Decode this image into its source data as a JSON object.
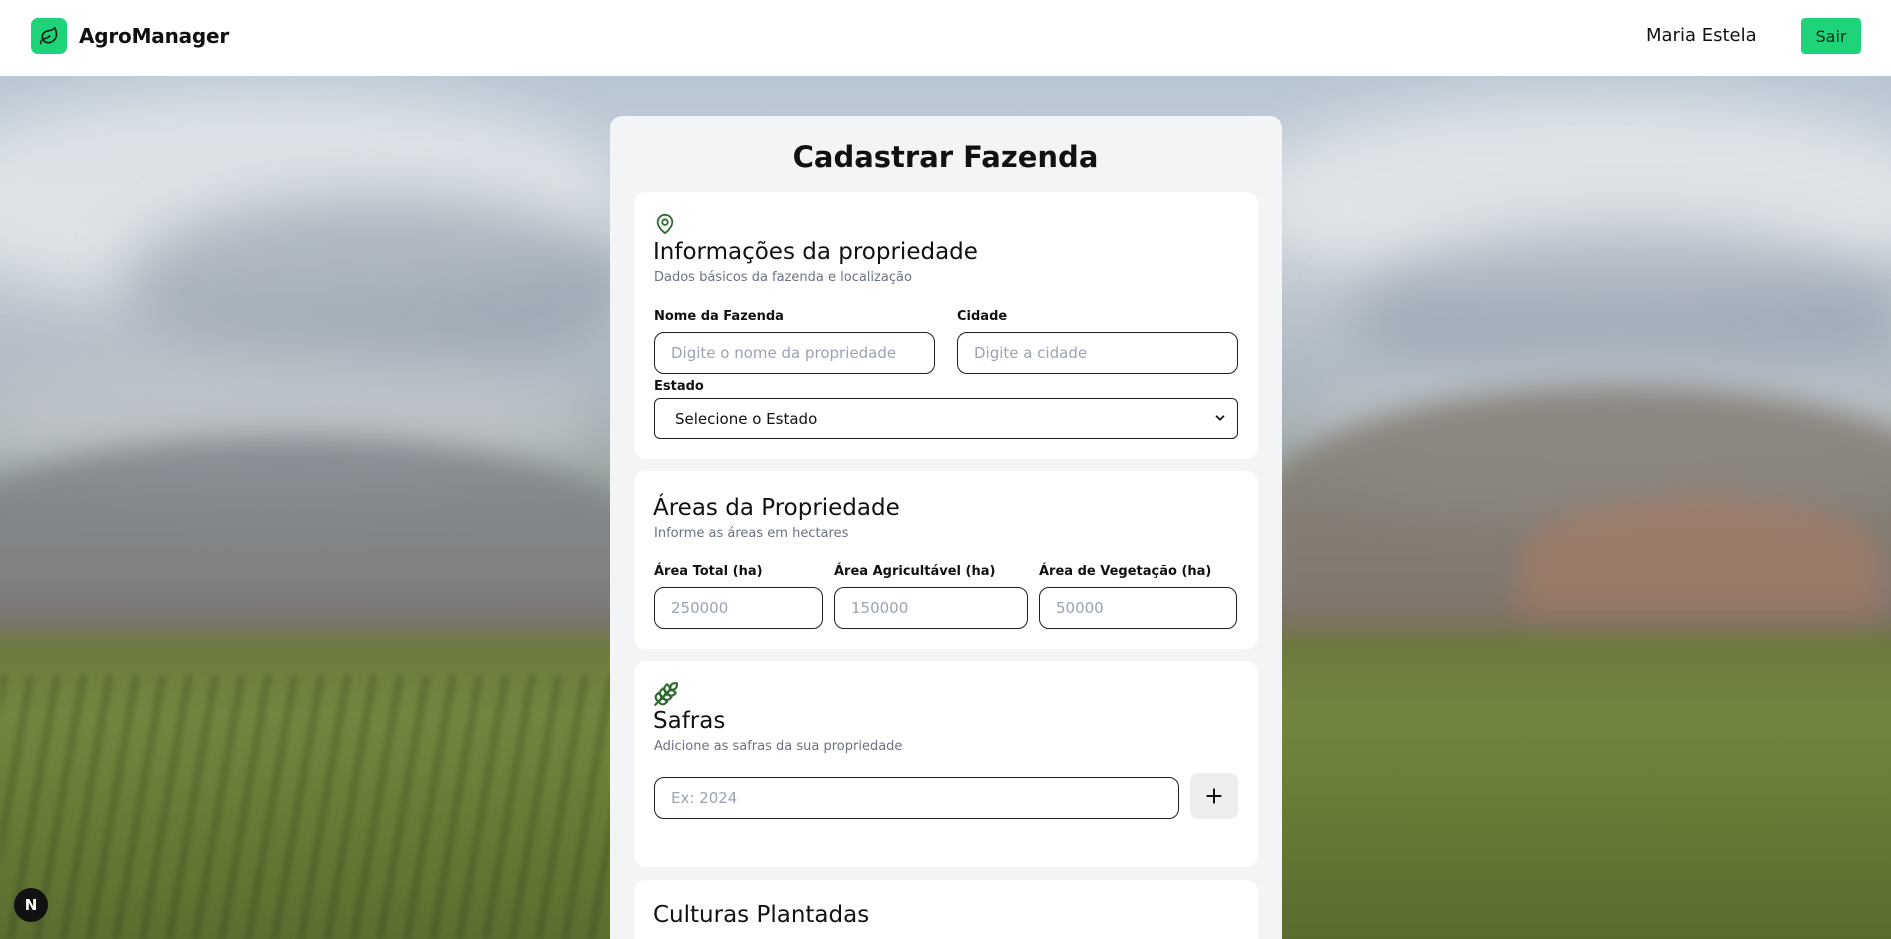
{
  "header": {
    "brand": "AgroManager",
    "user_name": "Maria Estela",
    "logout_label": "Sair",
    "accent_color": "#1fd37a",
    "logo_icon": "leaf-icon"
  },
  "form": {
    "title": "Cadastrar Fazenda",
    "property_section": {
      "icon": "map-pin-icon",
      "title": "Informações da propriedade",
      "subtitle": "Dados básicos da fazenda e localização",
      "farm_name_label": "Nome da Fazenda",
      "farm_name_placeholder": "Digite o nome da propriedade",
      "city_label": "Cidade",
      "city_placeholder": "Digite a cidade",
      "state_label": "Estado",
      "state_selected": "Selecione o Estado"
    },
    "areas_section": {
      "title": "Áreas da Propriedade",
      "subtitle": "Informe as áreas em hectares",
      "total_label": "Área Total (ha)",
      "total_placeholder": "250000",
      "arable_label": "Área Agricultável (ha)",
      "arable_placeholder": "150000",
      "vegetation_label": "Área de Vegetação (ha)",
      "vegetation_placeholder": "50000"
    },
    "harvests_section": {
      "icon": "wheat-icon",
      "title": "Safras",
      "subtitle": "Adicione as safras da sua propriedade",
      "harvest_placeholder": "Ex: 2024",
      "add_label": "+"
    },
    "crops_section": {
      "title": "Culturas Plantadas"
    }
  },
  "dev_badge": "N"
}
